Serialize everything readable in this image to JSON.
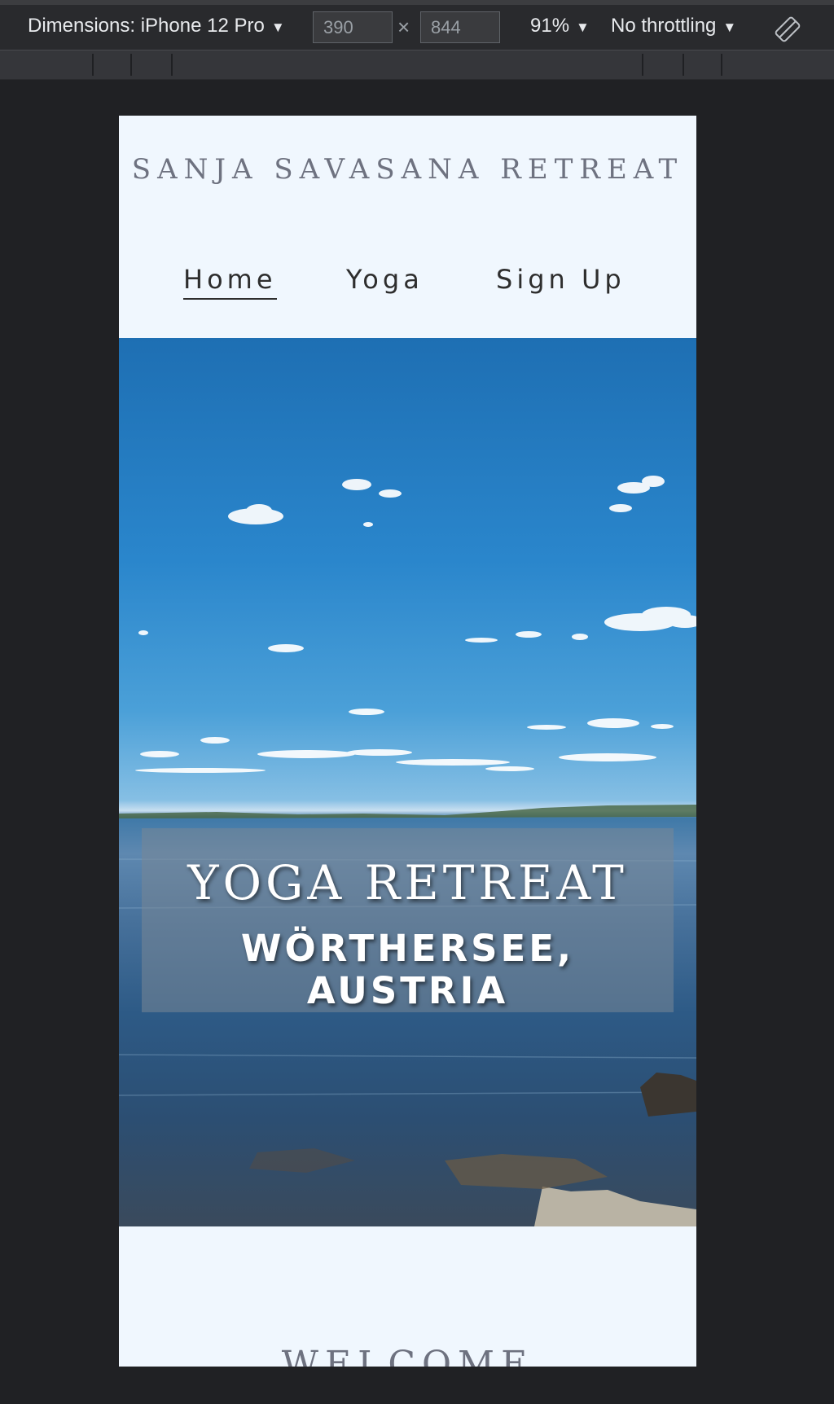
{
  "devtools": {
    "dimensions_label": "Dimensions: iPhone 12 Pro",
    "width_value": "390",
    "height_value": "844",
    "times": "×",
    "zoom": "91%",
    "throttling": "No throttling",
    "caret": "▼",
    "rotate_icon": "rotate-device-icon"
  },
  "site": {
    "title": "SANJA SAVASANA RETREAT",
    "nav": [
      {
        "label": "Home",
        "active": true
      },
      {
        "label": "Yoga",
        "active": false
      },
      {
        "label": "Sign Up",
        "active": false
      }
    ],
    "hero": {
      "heading": "YOGA RETREAT",
      "subheading": "WÖRTHERSEE, AUSTRIA"
    },
    "welcome": "WELCOME"
  }
}
